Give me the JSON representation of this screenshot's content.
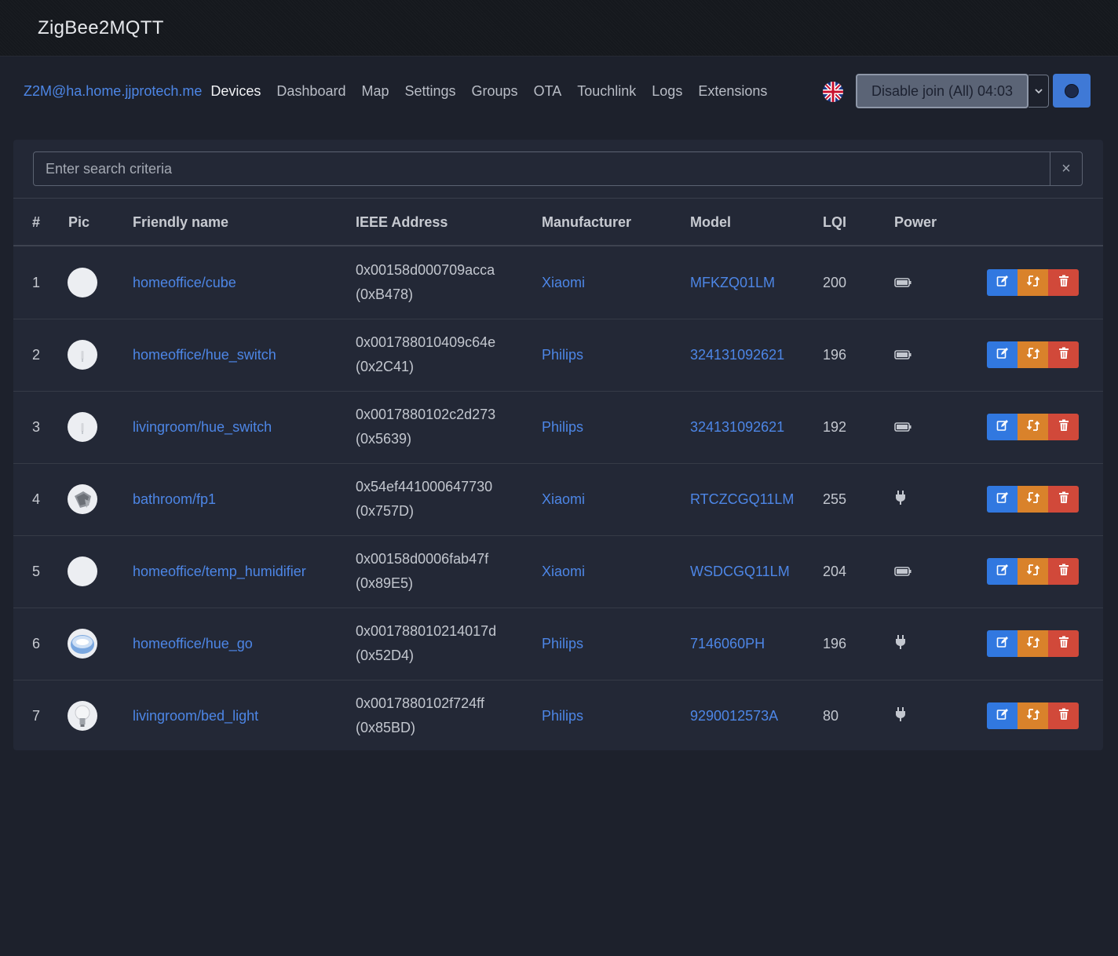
{
  "window": {
    "title": "ZigBee2MQTT"
  },
  "navbar": {
    "brand": "Z2M@ha.home.jjprotech.me",
    "items": [
      "Devices",
      "Dashboard",
      "Map",
      "Settings",
      "Groups",
      "OTA",
      "Touchlink",
      "Logs",
      "Extensions"
    ],
    "active": "Devices",
    "join_button": "Disable join (All) 04:03"
  },
  "search": {
    "placeholder": "Enter search criteria",
    "clear": "×"
  },
  "table": {
    "headers": [
      "#",
      "Pic",
      "Friendly name",
      "IEEE Address",
      "Manufacturer",
      "Model",
      "LQI",
      "Power"
    ],
    "rows": [
      {
        "num": "1",
        "name": "homeoffice/cube",
        "ieee": "0x00158d000709acca",
        "nwk": "(0xB478)",
        "manufacturer": "Xiaomi",
        "model": "MFKZQ01LM",
        "lqi": "200",
        "power": "battery-icon",
        "pic": "plain"
      },
      {
        "num": "2",
        "name": "homeoffice/hue_switch",
        "ieee": "0x001788010409c64e",
        "nwk": "(0x2C41)",
        "manufacturer": "Philips",
        "model": "324131092621",
        "lqi": "196",
        "power": "battery-icon",
        "pic": "switch"
      },
      {
        "num": "3",
        "name": "livingroom/hue_switch",
        "ieee": "0x0017880102c2d273",
        "nwk": "(0x5639)",
        "manufacturer": "Philips",
        "model": "324131092621",
        "lqi": "192",
        "power": "battery-icon",
        "pic": "switch"
      },
      {
        "num": "4",
        "name": "bathroom/fp1",
        "ieee": "0x54ef441000647730",
        "nwk": "(0x757D)",
        "manufacturer": "Xiaomi",
        "model": "RTCZCGQ11LM",
        "lqi": "255",
        "power": "plug-icon",
        "pic": "sensor"
      },
      {
        "num": "5",
        "name": "homeoffice/temp_humidifier",
        "ieee": "0x00158d0006fab47f",
        "nwk": "(0x89E5)",
        "manufacturer": "Xiaomi",
        "model": "WSDCGQ11LM",
        "lqi": "204",
        "power": "battery-icon",
        "pic": "plain"
      },
      {
        "num": "6",
        "name": "homeoffice/hue_go",
        "ieee": "0x001788010214017d",
        "nwk": "(0x52D4)",
        "manufacturer": "Philips",
        "model": "7146060PH",
        "lqi": "196",
        "power": "plug-icon",
        "pic": "huego"
      },
      {
        "num": "7",
        "name": "livingroom/bed_light",
        "ieee": "0x0017880102f724ff",
        "nwk": "(0x85BD)",
        "manufacturer": "Philips",
        "model": "9290012573A",
        "lqi": "80",
        "power": "plug-icon",
        "pic": "bulb"
      }
    ]
  },
  "colors": {
    "background": "#1d212c",
    "card": "#232836",
    "link": "#4d86e6",
    "edit": "#3178e0",
    "swap": "#d9822b",
    "delete": "#d1493a"
  }
}
